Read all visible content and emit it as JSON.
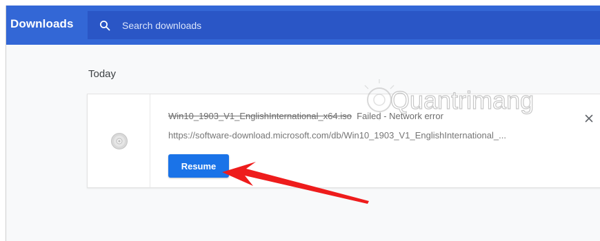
{
  "header": {
    "title": "Downloads",
    "search_placeholder": "Search downloads"
  },
  "section": {
    "title": "Today"
  },
  "download": {
    "file_name": "Win10_1903_V1_EnglishInternational_x64.iso",
    "status": "Failed - Network error",
    "url": "https://software-download.microsoft.com/db/Win10_1903_V1_EnglishInternational_...",
    "resume_label": "Resume",
    "remove_icon": "close-icon",
    "file_icon": "disc-icon"
  },
  "watermark": {
    "text": "Quantrimang"
  },
  "colors": {
    "header_bg": "#3367d6",
    "search_bg": "#2a56c6",
    "button_bg": "#1a73e8",
    "arrow": "#ee1c1c"
  }
}
